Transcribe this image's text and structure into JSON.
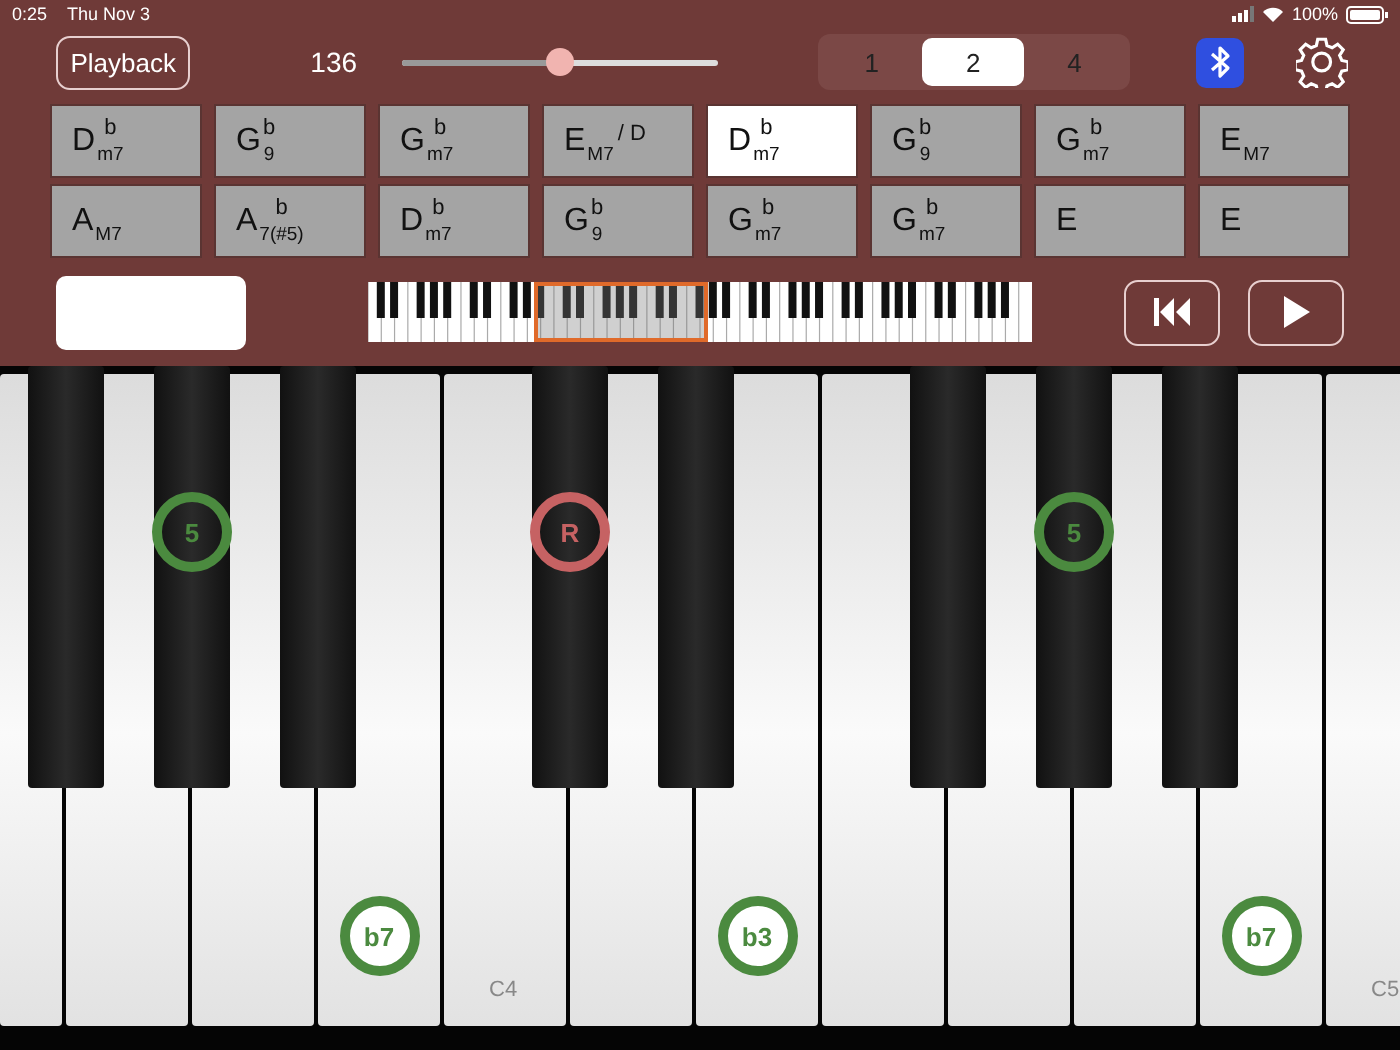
{
  "status_bar": {
    "time": "0:25",
    "date": "Thu Nov 3",
    "battery": "100%"
  },
  "toolbar": {
    "playback_button": "Playback",
    "tempo": "136",
    "tempo_slider": {
      "level": 0.5
    },
    "segments": [
      {
        "label": "1",
        "selected": false
      },
      {
        "label": "2",
        "selected": true
      },
      {
        "label": "4",
        "selected": false
      }
    ]
  },
  "chords": [
    {
      "root": "D",
      "accidental": "b",
      "quality": "m7",
      "selected": false
    },
    {
      "root": "G",
      "accidental": "b",
      "quality": "9",
      "selected": false
    },
    {
      "root": "G",
      "accidental": "b",
      "quality": "m7",
      "selected": false
    },
    {
      "root": "E",
      "quality": "M7",
      "bass": "/ D",
      "selected": false
    },
    {
      "root": "D",
      "accidental": "b",
      "quality": "m7",
      "selected": true
    },
    {
      "root": "G",
      "accidental": "b",
      "quality": "9",
      "selected": false
    },
    {
      "root": "G",
      "accidental": "b",
      "quality": "m7",
      "selected": false
    },
    {
      "root": "E",
      "quality": "M7",
      "selected": false
    },
    {
      "root": "A",
      "quality": "M7",
      "selected": false
    },
    {
      "root": "A",
      "accidental": "b",
      "quality": "7(#5)",
      "selected": false
    },
    {
      "root": "D",
      "accidental": "b",
      "quality": "m7",
      "selected": false
    },
    {
      "root": "G",
      "accidental": "b",
      "quality": "9",
      "selected": false
    },
    {
      "root": "G",
      "accidental": "b",
      "quality": "m7",
      "selected": false
    },
    {
      "root": "G",
      "accidental": "b",
      "quality": "m7",
      "selected": false
    },
    {
      "root": "E",
      "selected": false
    },
    {
      "root": "E",
      "selected": false
    }
  ],
  "piano": {
    "keys": [
      {
        "kind": "white"
      },
      {
        "kind": "black"
      },
      {
        "kind": "white"
      },
      {
        "kind": "black",
        "degree": "5",
        "color": "#4b8a3f"
      },
      {
        "kind": "white"
      },
      {
        "kind": "black"
      },
      {
        "kind": "white",
        "degree": "b7",
        "color": "#4b8a3f"
      },
      {
        "kind": "white",
        "label": "C4"
      },
      {
        "kind": "black",
        "degree": "R",
        "color": "#c66263"
      },
      {
        "kind": "white"
      },
      {
        "kind": "black"
      },
      {
        "kind": "white",
        "degree": "b3",
        "color": "#4b8a3f"
      },
      {
        "kind": "white"
      },
      {
        "kind": "black"
      },
      {
        "kind": "white"
      },
      {
        "kind": "black",
        "degree": "5",
        "color": "#4b8a3f"
      },
      {
        "kind": "white"
      },
      {
        "kind": "black"
      },
      {
        "kind": "white",
        "degree": "b7",
        "color": "#4b8a3f"
      },
      {
        "kind": "white",
        "label": "C5"
      }
    ]
  }
}
